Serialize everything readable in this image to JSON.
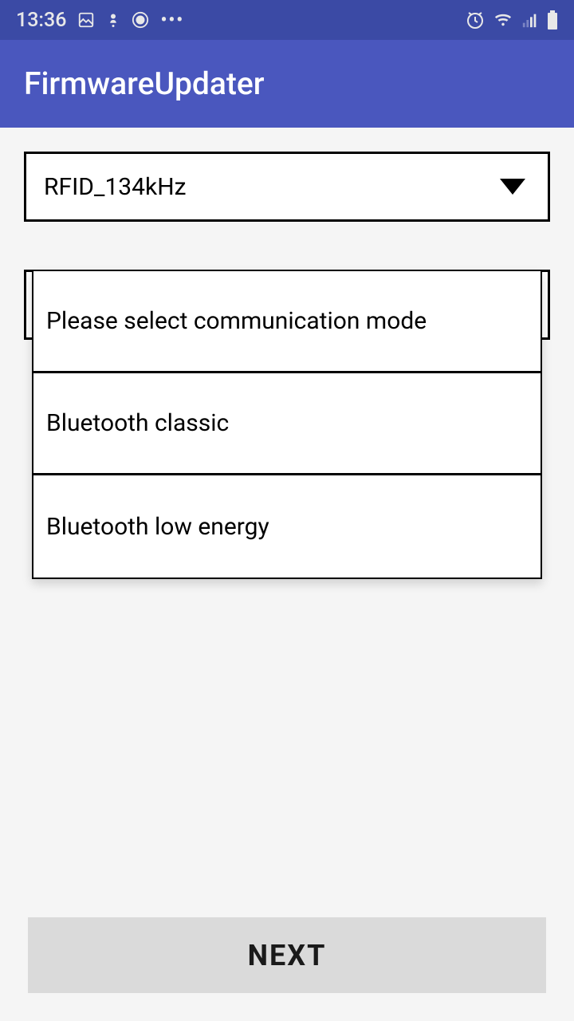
{
  "status": {
    "time": "13:36"
  },
  "app": {
    "title": "FirmwareUpdater"
  },
  "spinner1": {
    "selected": "RFID_134kHz"
  },
  "dropdown": {
    "options": [
      "Please select communication mode",
      "Bluetooth classic",
      "Bluetooth low energy"
    ]
  },
  "button": {
    "next": "NEXT"
  }
}
